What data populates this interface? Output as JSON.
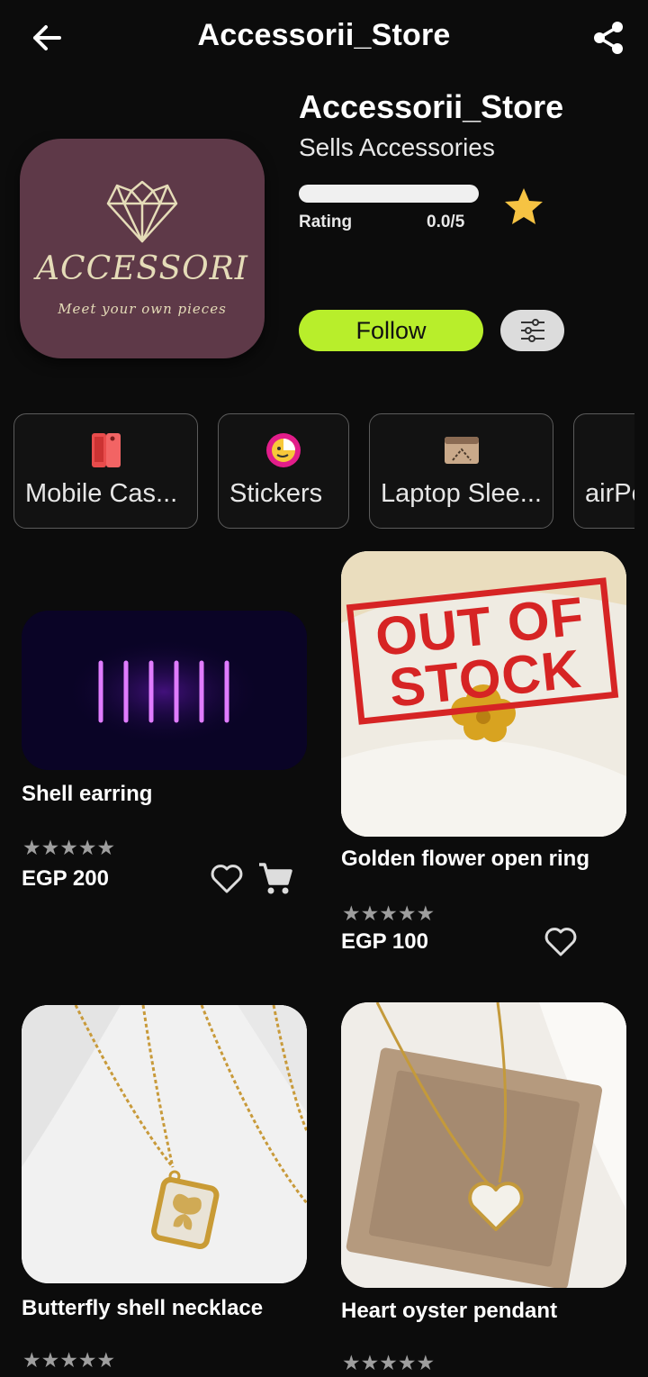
{
  "header": {
    "title": "Accessorii_Store"
  },
  "store": {
    "name": "Accessorii_Store",
    "description": "Sells Accessories",
    "rating_label": "Rating",
    "rating_value": "0.0/5",
    "rating_fraction": 0,
    "follow_label": "Follow",
    "logo": {
      "word": "ACCESSORI",
      "tagline": "Meet your own pieces",
      "bg_color": "#5e3948"
    }
  },
  "categories": [
    {
      "label": "Mobile Cas...",
      "icon": "phone-case-icon"
    },
    {
      "label": "Stickers",
      "icon": "sticker-icon"
    },
    {
      "label": "Laptop Slee...",
      "icon": "laptop-sleeve-icon"
    },
    {
      "label": "airPo",
      "icon": ""
    }
  ],
  "products": [
    {
      "name": "Shell earring",
      "stars": "★★★★★",
      "price": "EGP 200",
      "image": "neon-bars-image"
    },
    {
      "name": "Golden flower open ring",
      "stars": "★★★★★",
      "price": "EGP 100",
      "stamp": "OUT OF STOCK",
      "image": "gold-ring-image"
    },
    {
      "name": "Butterfly shell necklace",
      "stars": "★★★★★",
      "image": "butterfly-necklace-image"
    },
    {
      "name": "Heart oyster pendant",
      "stars": "★★★★★",
      "image": "heart-pendant-image"
    }
  ],
  "colors": {
    "accent": "#b8ee2b",
    "star": "#f6c343",
    "stamp": "#d62424",
    "background": "#0c0c0c"
  }
}
